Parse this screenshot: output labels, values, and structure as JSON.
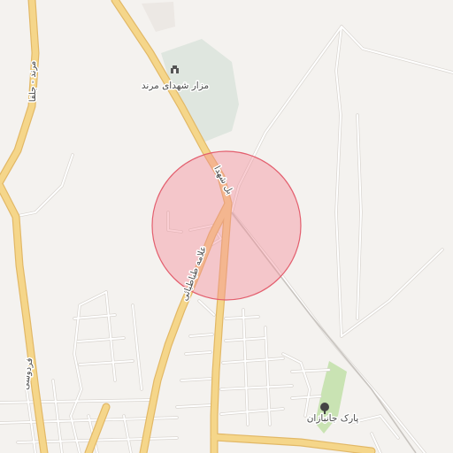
{
  "map": {
    "labels": {
      "road_marand_jolfa": "مرند - جلفا",
      "road_ferdowsi": "فردوسی",
      "road_shohada": "بل شهدا",
      "road_allameh": "علامه طباطبائی",
      "poi_cemetery": "مزار شهدای مرند",
      "poi_park": "پارک جانبازان"
    },
    "icons": {
      "cemetery": "monument-icon",
      "park": "tree-icon"
    },
    "colors": {
      "background": "#f4f2ef",
      "major_road": "#f5d68a",
      "major_road_casing": "#e2b866",
      "minor_road": "#ffffff",
      "minor_road_casing": "#d8d4cf",
      "green_area": "#dfe6df",
      "park_green": "#c9e3b3",
      "radius_fill": "#f28a96",
      "radius_stroke": "#e35f6e"
    }
  }
}
